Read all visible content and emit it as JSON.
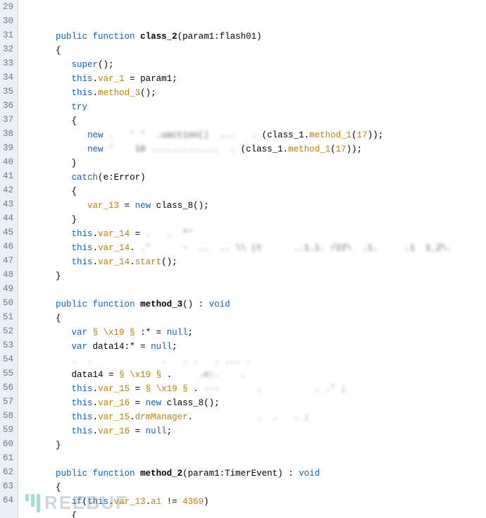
{
  "gutter": {
    "start": 29,
    "end": 64
  },
  "code": [
    {
      "indent": 2,
      "runs": [
        [
          "kw",
          "public function "
        ],
        [
          "name",
          "class_2"
        ],
        [
          "punct",
          "("
        ],
        [
          "",
          "param1"
        ],
        [
          "punct",
          ":"
        ],
        [
          "",
          "flash01"
        ],
        [
          "punct",
          ")"
        ]
      ]
    },
    {
      "indent": 2,
      "runs": [
        [
          "punct",
          "{"
        ]
      ]
    },
    {
      "indent": 3,
      "runs": [
        [
          "kw",
          "super"
        ],
        [
          "punct",
          "();"
        ]
      ]
    },
    {
      "indent": 3,
      "runs": [
        [
          "this",
          "this"
        ],
        [
          "punct",
          "."
        ],
        [
          "mem",
          "var_1"
        ],
        [
          "punct",
          " = "
        ],
        [
          "",
          "param1"
        ],
        [
          "punct",
          ";"
        ]
      ]
    },
    {
      "indent": 3,
      "runs": [
        [
          "this",
          "this"
        ],
        [
          "punct",
          "."
        ],
        [
          "mem",
          "method_3"
        ],
        [
          "punct",
          "();"
        ]
      ]
    },
    {
      "indent": 3,
      "runs": [
        [
          "kw",
          "try"
        ]
      ]
    },
    {
      "indent": 3,
      "runs": [
        [
          "punct",
          "{"
        ]
      ]
    },
    {
      "indent": 4,
      "runs": [
        [
          "kw",
          "new "
        ],
        [
          "blur",
          ".   ' '  .uaction()  ...   . "
        ],
        [
          "punct",
          "("
        ],
        [
          "",
          "class_1"
        ],
        [
          "punct",
          "."
        ],
        [
          "mem",
          "method_1"
        ],
        [
          "punct",
          "("
        ],
        [
          "num",
          "17"
        ],
        [
          "punct",
          "));"
        ]
      ]
    },
    {
      "indent": 4,
      "runs": [
        [
          "kw",
          "new "
        ],
        [
          "blur",
          "'    10 .............  . "
        ],
        [
          "punct",
          "("
        ],
        [
          "",
          "class_1"
        ],
        [
          "punct",
          "."
        ],
        [
          "mem",
          "method_1"
        ],
        [
          "punct",
          "("
        ],
        [
          "num",
          "17"
        ],
        [
          "punct",
          "));"
        ]
      ]
    },
    {
      "indent": 3,
      "runs": [
        [
          "punct",
          "}"
        ]
      ]
    },
    {
      "indent": 3,
      "runs": [
        [
          "kw",
          "catch"
        ],
        [
          "punct",
          "("
        ],
        [
          "",
          "e"
        ],
        [
          "punct",
          ":"
        ],
        [
          "",
          "Error"
        ],
        [
          "punct",
          ")"
        ]
      ]
    },
    {
      "indent": 3,
      "runs": [
        [
          "punct",
          "{"
        ]
      ]
    },
    {
      "indent": 4,
      "runs": [
        [
          "mem",
          "var_13"
        ],
        [
          "punct",
          " = "
        ],
        [
          "kw",
          "new "
        ],
        [
          "",
          "class_8"
        ],
        [
          "punct",
          "();"
        ]
      ]
    },
    {
      "indent": 3,
      "runs": [
        [
          "punct",
          "}"
        ]
      ]
    },
    {
      "indent": 3,
      "runs": [
        [
          "this",
          "this"
        ],
        [
          "punct",
          "."
        ],
        [
          "mem",
          "var_14"
        ],
        [
          "punct",
          " = "
        ],
        [
          "blur",
          ".   .  \"'"
        ]
      ]
    },
    {
      "indent": 3,
      "runs": [
        [
          "this",
          "this"
        ],
        [
          "punct",
          "."
        ],
        [
          "mem",
          "var_14"
        ],
        [
          "punct",
          "."
        ],
        [
          "blur",
          " .'      -  ..  .. \\\\ (t      ..1.1. /22\\  .1.     .1  1_2\\."
        ]
      ]
    },
    {
      "indent": 3,
      "runs": [
        [
          "this",
          "this"
        ],
        [
          "punct",
          "."
        ],
        [
          "mem",
          "var_14"
        ],
        [
          "punct",
          "."
        ],
        [
          "mem",
          "start"
        ],
        [
          "punct",
          "();"
        ]
      ]
    },
    {
      "indent": 2,
      "runs": [
        [
          "punct",
          "}"
        ]
      ]
    },
    {
      "indent": 0,
      "runs": [
        [
          "",
          ""
        ]
      ]
    },
    {
      "indent": 2,
      "runs": [
        [
          "kw",
          "public function "
        ],
        [
          "name",
          "method_3"
        ],
        [
          "punct",
          "() : "
        ],
        [
          "kw",
          "void"
        ]
      ]
    },
    {
      "indent": 2,
      "runs": [
        [
          "punct",
          "{"
        ]
      ]
    },
    {
      "indent": 3,
      "runs": [
        [
          "kw",
          "var "
        ],
        [
          "mem",
          "§ \\x19 §"
        ],
        [
          "punct",
          " :* = "
        ],
        [
          "kw",
          "null"
        ],
        [
          "punct",
          ";"
        ]
      ]
    },
    {
      "indent": 3,
      "runs": [
        [
          "kw",
          "var "
        ],
        [
          "",
          "data14"
        ],
        [
          "punct",
          ":* = "
        ],
        [
          "kw",
          "null"
        ],
        [
          "punct",
          ";"
        ]
      ]
    },
    {
      "indent": 3,
      "runs": [
        [
          "blur",
          ".  .             .   . .   . ... ."
        ]
      ]
    },
    {
      "indent": 3,
      "runs": [
        [
          "",
          "data14"
        ],
        [
          "punct",
          " = "
        ],
        [
          "mem",
          "§ \\x19 §"
        ],
        [
          "punct",
          " . "
        ],
        [
          "blur",
          "    .n:.    ."
        ]
      ]
    },
    {
      "indent": 3,
      "runs": [
        [
          "this",
          "this"
        ],
        [
          "punct",
          "."
        ],
        [
          "mem",
          "var_15"
        ],
        [
          "punct",
          " = "
        ],
        [
          "mem",
          "§ \\x19 §"
        ],
        [
          "punct",
          " . "
        ],
        [
          "blur",
          "---       .          . .' ;"
        ]
      ]
    },
    {
      "indent": 3,
      "runs": [
        [
          "this",
          "this"
        ],
        [
          "punct",
          "."
        ],
        [
          "mem",
          "var_16"
        ],
        [
          "punct",
          " = "
        ],
        [
          "kw",
          "new "
        ],
        [
          "",
          "class_8"
        ],
        [
          "punct",
          "();"
        ]
      ]
    },
    {
      "indent": 3,
      "runs": [
        [
          "this",
          "this"
        ],
        [
          "punct",
          "."
        ],
        [
          "mem",
          "var_15"
        ],
        [
          "punct",
          "."
        ],
        [
          "mem",
          "drmManager"
        ],
        [
          "punct",
          "."
        ],
        [
          "blur",
          "            .  .   . ;"
        ]
      ]
    },
    {
      "indent": 3,
      "runs": [
        [
          "this",
          "this"
        ],
        [
          "punct",
          "."
        ],
        [
          "mem",
          "var_16"
        ],
        [
          "punct",
          " = "
        ],
        [
          "kw",
          "null"
        ],
        [
          "punct",
          ";"
        ]
      ]
    },
    {
      "indent": 2,
      "runs": [
        [
          "punct",
          "}"
        ]
      ]
    },
    {
      "indent": 0,
      "runs": [
        [
          "",
          ""
        ]
      ]
    },
    {
      "indent": 2,
      "runs": [
        [
          "kw",
          "public function "
        ],
        [
          "name",
          "method_2"
        ],
        [
          "punct",
          "("
        ],
        [
          "",
          "param1"
        ],
        [
          "punct",
          ":"
        ],
        [
          "",
          "TimerEvent"
        ],
        [
          "punct",
          ") : "
        ],
        [
          "kw",
          "void"
        ]
      ]
    },
    {
      "indent": 2,
      "runs": [
        [
          "punct",
          "{"
        ]
      ]
    },
    {
      "indent": 3,
      "runs": [
        [
          "kw",
          "if"
        ],
        [
          "punct",
          "("
        ],
        [
          "this",
          "this"
        ],
        [
          "punct",
          "."
        ],
        [
          "mem",
          "var_13"
        ],
        [
          "punct",
          "."
        ],
        [
          "mem",
          "a1"
        ],
        [
          "punct",
          " != "
        ],
        [
          "num",
          "4369"
        ],
        [
          "punct",
          ")"
        ]
      ]
    },
    {
      "indent": 3,
      "runs": [
        [
          "punct",
          "{"
        ]
      ]
    }
  ],
  "watermark": "REEBUF"
}
